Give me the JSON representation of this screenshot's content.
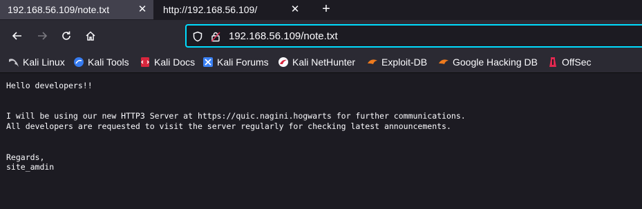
{
  "tabs": [
    {
      "title": "192.168.56.109/note.txt",
      "active": true
    },
    {
      "title": "http://192.168.56.109/",
      "active": false
    }
  ],
  "toolbar": {
    "back_icon": "arrow-left-icon",
    "forward_icon": "arrow-right-icon",
    "reload_icon": "reload-icon",
    "home_icon": "home-icon",
    "url": "192.168.56.109/note.txt"
  },
  "bookmarks": [
    {
      "label": "Kali Linux",
      "icon": "kali-dragon-icon"
    },
    {
      "label": "Kali Tools",
      "icon": "kali-tools-icon"
    },
    {
      "label": "Kali Docs",
      "icon": "kali-docs-icon"
    },
    {
      "label": "Kali Forums",
      "icon": "kali-forums-icon"
    },
    {
      "label": "Kali NetHunter",
      "icon": "nethunter-icon"
    },
    {
      "label": "Exploit-DB",
      "icon": "exploit-db-icon"
    },
    {
      "label": "Google Hacking DB",
      "icon": "ghdb-icon"
    },
    {
      "label": "OffSec",
      "icon": "offsec-icon"
    }
  ],
  "document": {
    "text": "Hello developers!!\n\n\nI will be using our new HTTP3 Server at https://quic.nagini.hogwarts for further communications.\nAll developers are requested to visit the server regularly for checking latest announcements.\n\n\nRegards,\nsite_amdin"
  },
  "colors": {
    "focus_ring": "#00ddff",
    "background": "#1c1b22",
    "toolbar": "#2b2a33"
  }
}
